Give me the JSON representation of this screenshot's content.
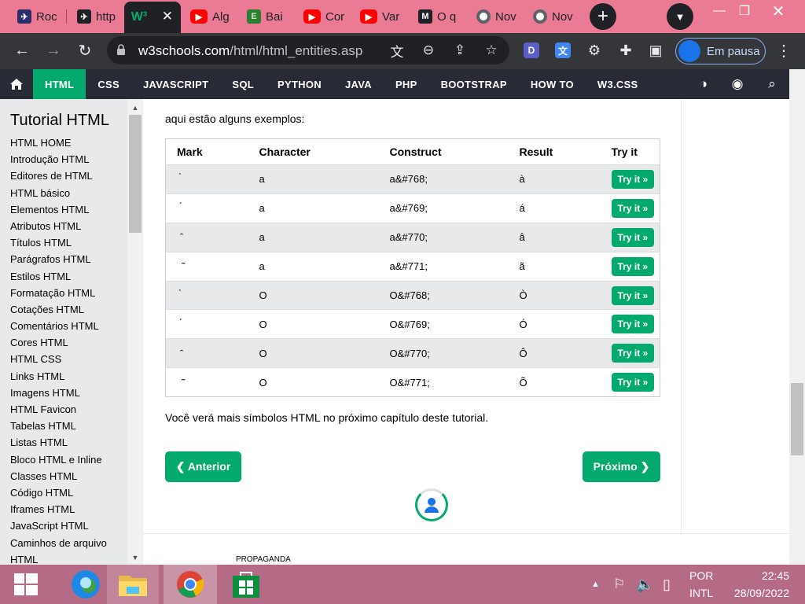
{
  "browser": {
    "tabs": [
      {
        "title": "Roc",
        "favicon": "rocket-icon",
        "color": "#2d2d6b"
      },
      {
        "title": "http",
        "favicon": "rocket-icon",
        "color": "#202124"
      },
      {
        "title": "W³",
        "favicon": "w3schools-icon",
        "color": "#04aa6d",
        "active": true
      },
      {
        "title": "Alg",
        "favicon": "youtube-icon",
        "color": "#ff0000"
      },
      {
        "title": "Bai",
        "favicon": "editor-icon",
        "color": "#4caf50"
      },
      {
        "title": "Cor",
        "favicon": "youtube-icon",
        "color": "#ff0000"
      },
      {
        "title": "Var",
        "favicon": "youtube-icon",
        "color": "#ff0000"
      },
      {
        "title": "O q",
        "favicon": "medium-icon",
        "color": "#202124"
      },
      {
        "title": "Nov",
        "favicon": "chrome-icon",
        "color": "#5f6368"
      },
      {
        "title": "Nov",
        "favicon": "chrome-icon",
        "color": "#5f6368"
      }
    ],
    "url_domain": "w3schools.com",
    "url_path": "/html/html_entities.asp",
    "profile_label": "Em pausa"
  },
  "w3nav": {
    "items": [
      "HTML",
      "CSS",
      "JAVASCRIPT",
      "SQL",
      "PYTHON",
      "JAVA",
      "PHP",
      "BOOTSTRAP",
      "HOW TO",
      "W3.CSS"
    ]
  },
  "sidebar": {
    "title": "Tutorial HTML",
    "links": [
      "HTML HOME",
      "Introdução HTML",
      "Editores de HTML",
      "HTML básico",
      "Elementos HTML",
      "Atributos HTML",
      "Títulos HTML",
      "Parágrafos HTML",
      "Estilos HTML",
      "Formatação HTML",
      "Cotações HTML",
      "Comentários HTML",
      "Cores HTML",
      "HTML CSS",
      "Links HTML",
      "Imagens HTML",
      "HTML Favicon",
      "Tabelas HTML",
      "Listas HTML",
      "Bloco HTML e Inline",
      "Classes HTML",
      "Código HTML",
      "Iframes HTML",
      "JavaScript HTML",
      "Caminhos de arquivo",
      "HTML"
    ]
  },
  "content": {
    "intro": "aqui estão alguns exemplos:",
    "columns": [
      "Mark",
      "Character",
      "Construct",
      "Result",
      "Try it"
    ],
    "rows": [
      {
        "mark": "̀",
        "character": "a",
        "construct": "a&#768;",
        "result": "à",
        "button": "Try it »"
      },
      {
        "mark": "́",
        "character": "a",
        "construct": "a&#769;",
        "result": "á",
        "button": "Try it »"
      },
      {
        "mark": "̂",
        "character": "a",
        "construct": "a&#770;",
        "result": "â",
        "button": "Try it »"
      },
      {
        "mark": "̃",
        "character": "a",
        "construct": "a&#771;",
        "result": "ã",
        "button": "Try it »"
      },
      {
        "mark": "̀",
        "character": "O",
        "construct": "O&#768;",
        "result": "Ò",
        "button": "Try it »"
      },
      {
        "mark": "́",
        "character": "O",
        "construct": "O&#769;",
        "result": "Ó",
        "button": "Try it »"
      },
      {
        "mark": "̂",
        "character": "O",
        "construct": "O&#770;",
        "result": "Ô",
        "button": "Try it »"
      },
      {
        "mark": "̃",
        "character": "O",
        "construct": "O&#771;",
        "result": "Õ",
        "button": "Try it »"
      }
    ],
    "after": "Você verá mais símbolos HTML no próximo capítulo deste tutorial.",
    "prev_label": "❮ Anterior",
    "next_label": "Próximo ❯",
    "ad_label": "PROPAGANDA"
  },
  "taskbar": {
    "lang_line1": "POR",
    "lang_line2": "INTL",
    "time": "22:45",
    "date": "28/09/2022"
  },
  "colors": {
    "accent": "#04aa6d",
    "nav_bg": "#282a35",
    "tabstrip": "#eb7a95",
    "taskbar": "#b56b86"
  }
}
